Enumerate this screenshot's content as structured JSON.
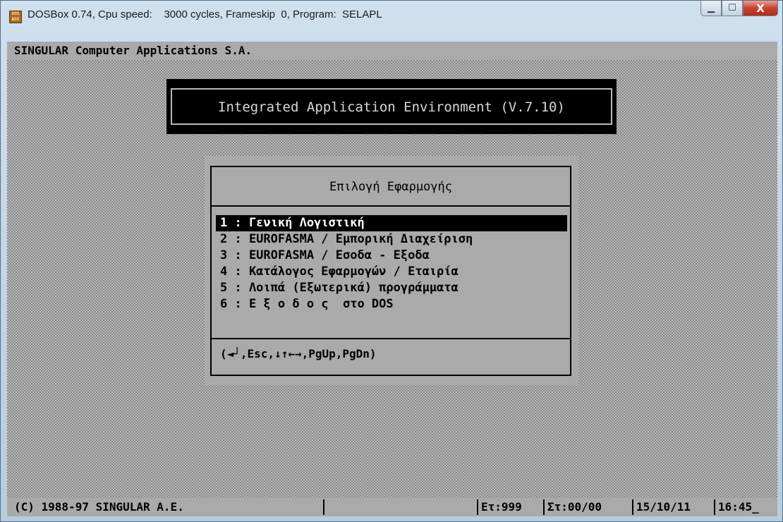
{
  "window": {
    "app_icon_label": "DOS BOX",
    "title": "DOSBox 0.74, Cpu speed:    3000 cycles, Frameskip  0, Program:  SELAPL",
    "minimize_symbol": "▁",
    "maximize_symbol": "☐",
    "close_symbol": "X"
  },
  "screen": {
    "top_line": "SINGULAR Computer Applications S.A.",
    "product_title": "Integrated Application Environment (V.7.10)",
    "menu": {
      "title": "Επιλογή Εφαρμογής",
      "items": [
        {
          "text": "1 : Γενική Λογιστική",
          "selected": true
        },
        {
          "text": "2 : EUROFASMA / Εμπορική Διαχείριση",
          "selected": false
        },
        {
          "text": "3 : EUROFASMA / Εσοδα - Εξοδα",
          "selected": false
        },
        {
          "text": "4 : Κατάλογος Εφαρμογών / Εταιρία",
          "selected": false
        },
        {
          "text": "5 : Λοιπά (Εξωτερικά) προγράμματα",
          "selected": false
        },
        {
          "text": "6 : Ε ξ ο δ ο ς  στο DOS",
          "selected": false
        }
      ],
      "hint": "(◄┘,Esc,↓↑←→,PgUp,PgDn)"
    },
    "status": {
      "copyright": "(C) 1988-97 SINGULAR A.E.",
      "et": "Ετ:999",
      "st": "Στ:00/00",
      "date": "15/10/11",
      "time": "16:45_"
    }
  }
}
